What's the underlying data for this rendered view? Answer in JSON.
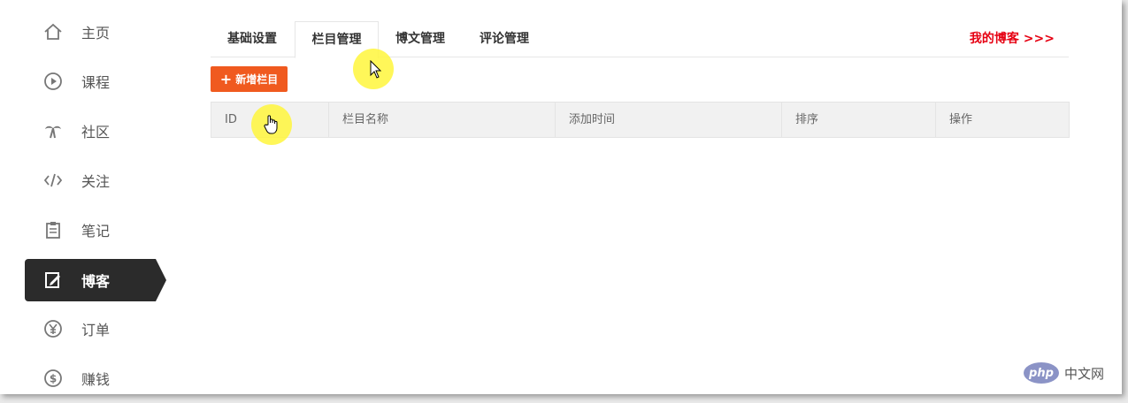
{
  "sidebar": {
    "items": [
      {
        "label": "主页",
        "icon": "home-icon"
      },
      {
        "label": "课程",
        "icon": "play-circle-icon"
      },
      {
        "label": "社区",
        "icon": "palm-tree-icon"
      },
      {
        "label": "关注",
        "icon": "code-icon"
      },
      {
        "label": "笔记",
        "icon": "clipboard-icon"
      },
      {
        "label": "博客",
        "icon": "edit-square-icon",
        "active": true
      },
      {
        "label": "订单",
        "icon": "yen-circle-icon"
      },
      {
        "label": "赚钱",
        "icon": "dollar-circle-icon"
      }
    ]
  },
  "tabs": [
    {
      "label": "基础设置"
    },
    {
      "label": "栏目管理",
      "active": true
    },
    {
      "label": "博文管理"
    },
    {
      "label": "评论管理"
    }
  ],
  "my_blog_link": "我的博客 >>>",
  "add_button": {
    "icon": "plus-icon",
    "label": "新增栏目"
  },
  "table": {
    "headers": [
      "ID",
      "栏目名称",
      "添加时间",
      "排序",
      "操作"
    ]
  },
  "watermark": {
    "logo": "php",
    "text": "中文网"
  },
  "colors": {
    "accent": "#f05a1f",
    "link": "#e60012",
    "active_nav": "#2b2b2b",
    "cursor_highlight": "#fff63c"
  }
}
